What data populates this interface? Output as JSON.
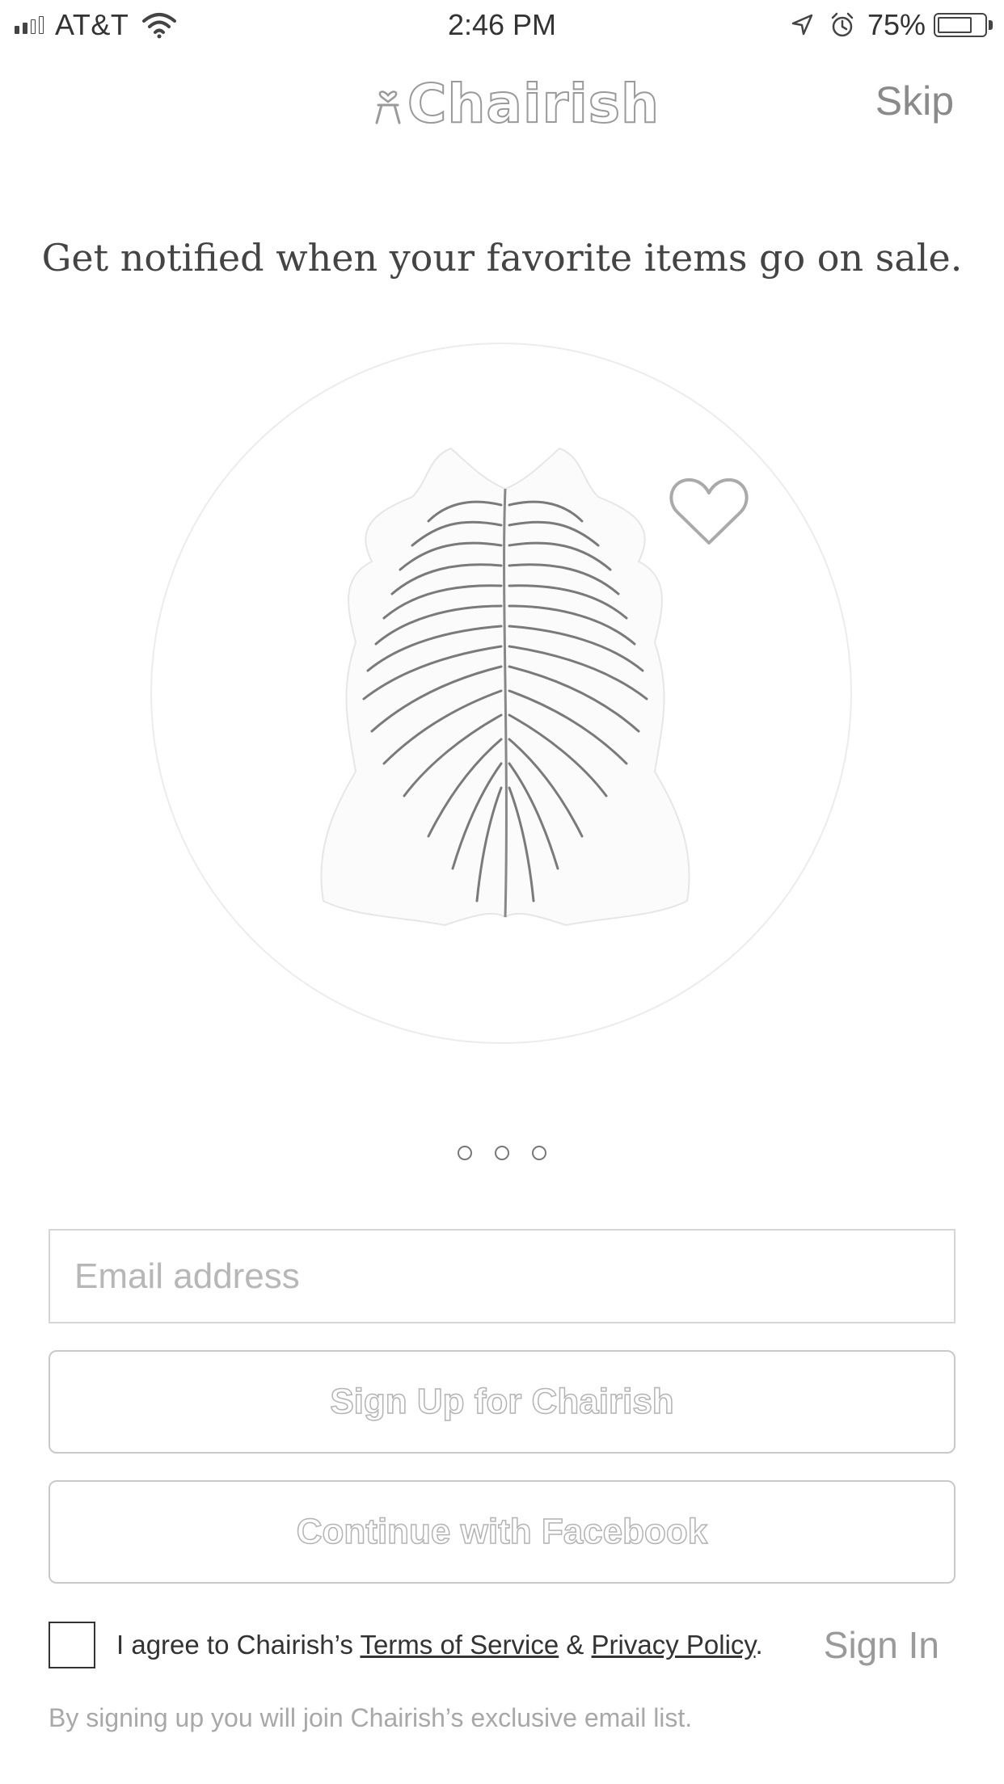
{
  "status_bar": {
    "carrier": "AT&T",
    "time": "2:46 PM",
    "battery_percent": "75%",
    "signal_bars_filled": 2,
    "signal_bars_total": 4,
    "icons": [
      "signal-icon",
      "wifi-icon",
      "location-arrow-icon",
      "alarm-icon",
      "battery-icon"
    ]
  },
  "header": {
    "logo_text": "Chairish",
    "logo_icon": "chair-heart-icon",
    "skip_label": "Skip"
  },
  "onboarding": {
    "headline": "Get notified when your favorite items go on sale.",
    "image_icon": "zebra-hide-rug-image",
    "favorite_icon": "heart-icon",
    "page_count": 3
  },
  "form": {
    "email_placeholder": "Email address",
    "email_value": "",
    "signup_label": "Sign Up for Chairish",
    "facebook_label": "Continue with Facebook",
    "agree_prefix": "I agree to Chairish’s",
    "terms_label": "Terms of Service",
    "agree_and": "&",
    "privacy_label": "Privacy Policy",
    "agree_suffix": ".",
    "agree_checked": false,
    "sign_in_label": "Sign In",
    "footnote": "By signing up you will join Chairish’s exclusive email list."
  },
  "colors": {
    "background": "#ffffff",
    "text": "#444444",
    "muted": "#9a9a9a",
    "border": "#c9c9c9"
  }
}
